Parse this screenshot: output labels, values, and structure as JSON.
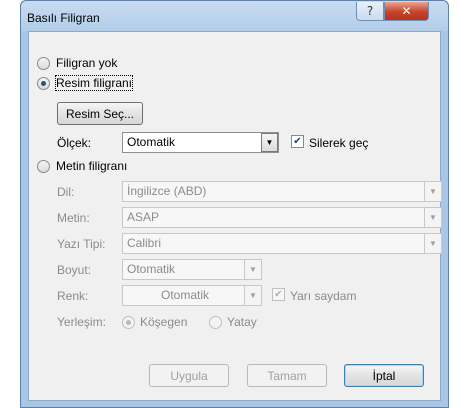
{
  "window": {
    "title": "Basılı Filigran",
    "help_glyph": "?",
    "close_glyph": "✕"
  },
  "options": {
    "no_watermark": "Filigran yok",
    "picture_watermark": "Resim filigranı",
    "text_watermark": "Metin filigranı",
    "selected": "picture_watermark"
  },
  "picture": {
    "select_button": "Resim Seç...",
    "scale_label": "Ölçek:",
    "scale_value": "Otomatik",
    "washout_label": "Silerek geç",
    "washout_checked": true
  },
  "text": {
    "language_label": "Dil:",
    "language_value": "İngilizce (ABD)",
    "text_label": "Metin:",
    "text_value": "ASAP",
    "font_label": "Yazı Tipi:",
    "font_value": "Calibri",
    "size_label": "Boyut:",
    "size_value": "Otomatik",
    "color_label": "Renk:",
    "color_value": "Otomatik",
    "semitransparent_label": "Yarı saydam",
    "semitransparent_checked": true,
    "layout_label": "Yerleşim:",
    "layout_diagonal": "Köşegen",
    "layout_horizontal": "Yatay",
    "layout_selected": "diagonal"
  },
  "footer": {
    "apply": "Uygula",
    "ok": "Tamam",
    "cancel": "İptal"
  },
  "colors": {
    "titlebar": "#b3cde9",
    "close": "#c6432a",
    "dialog_bg": "#f0f0f0"
  }
}
